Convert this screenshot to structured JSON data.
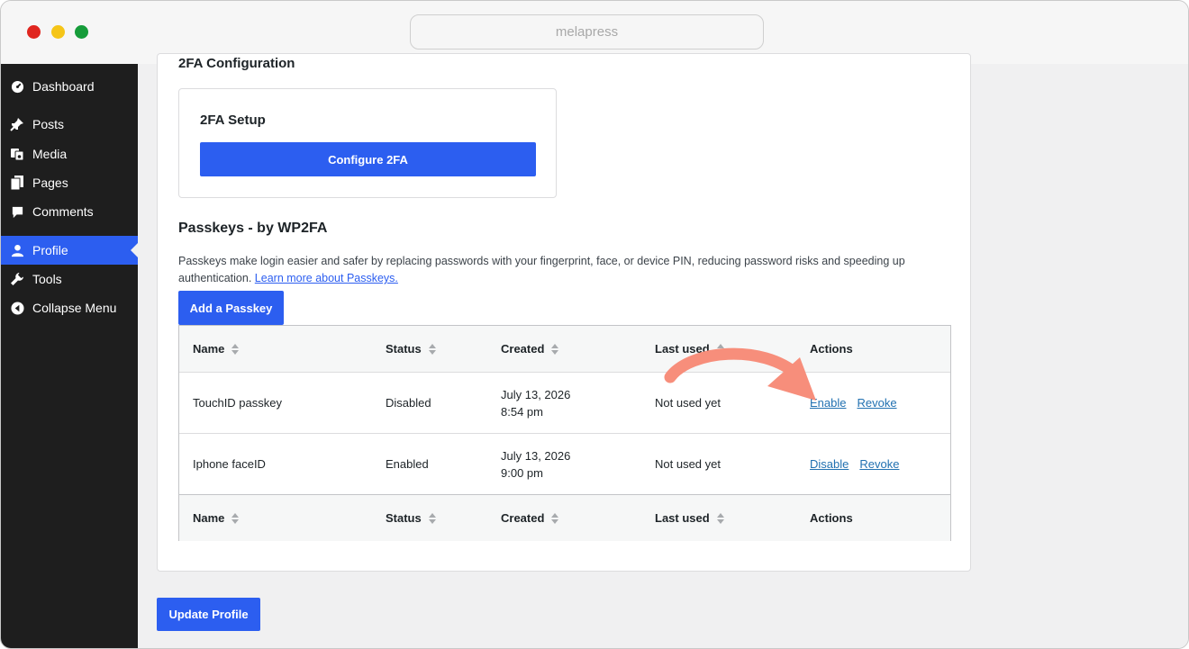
{
  "browser": {
    "url": "melapress"
  },
  "sidebar": {
    "items": [
      {
        "label": "Dashboard",
        "icon": "dashboard-icon"
      },
      {
        "label": "Posts",
        "icon": "pin-icon"
      },
      {
        "label": "Media",
        "icon": "media-icon"
      },
      {
        "label": "Pages",
        "icon": "pages-icon"
      },
      {
        "label": "Comments",
        "icon": "comments-icon"
      },
      {
        "label": "Profile",
        "icon": "user-icon",
        "active": true
      },
      {
        "label": "Tools",
        "icon": "wrench-icon"
      },
      {
        "label": "Collapse Menu",
        "icon": "collapse-icon"
      }
    ]
  },
  "config": {
    "heading": "2FA Configuration",
    "setup_title": "2FA Setup",
    "configure_label": "Configure 2FA"
  },
  "passkeys": {
    "heading": "Passkeys - by WP2FA",
    "description": "Passkeys make login easier and safer by replacing passwords with your fingerprint, face, or device PIN, reducing password risks and speeding up authentication.",
    "learn_more": "Learn more about Passkeys.",
    "add_label": "Add a Passkey",
    "columns": [
      "Name",
      "Status",
      "Created",
      "Last used",
      "Actions"
    ],
    "rows": [
      {
        "name": "TouchID passkey",
        "status": "Disabled",
        "created_date": "July 13, 2026",
        "created_time": "8:54 pm",
        "last_used": "Not used yet",
        "action_primary": "Enable",
        "action_secondary": "Revoke"
      },
      {
        "name": "Iphone faceID",
        "status": "Enabled",
        "created_date": "July 13, 2026",
        "created_time": "9:00 pm",
        "last_used": "Not used yet",
        "action_primary": "Disable",
        "action_secondary": "Revoke"
      }
    ]
  },
  "footer": {
    "update_label": "Update Profile"
  },
  "colors": {
    "accent": "#2c5ef0",
    "sidebar_bg": "#1e1e1e",
    "annotation_arrow": "#f78e7b"
  }
}
